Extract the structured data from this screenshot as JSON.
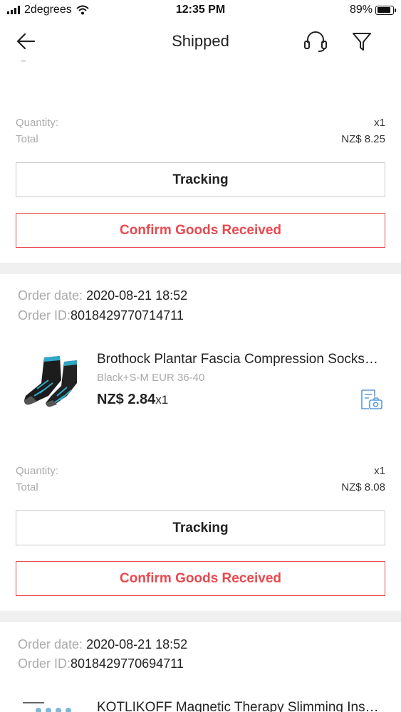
{
  "status_bar": {
    "carrier": "2degrees",
    "time": "12:35 PM",
    "battery_percent": "89%",
    "battery_level": 0.89
  },
  "nav": {
    "title": "Shipped",
    "icons": [
      "back-arrow-icon",
      "headset-icon",
      "filter-icon"
    ]
  },
  "orders": [
    {
      "quantity_label": "Quantity:",
      "quantity": "x1",
      "total_label": "Total",
      "total": "NZ$ 8.25",
      "tracking_label": "Tracking",
      "confirm_label": "Confirm Goods Received"
    },
    {
      "order_date_label": "Order date:",
      "order_date": "2020-08-21 18:52",
      "order_id_label": "Order ID:",
      "order_id": "8018429770714711",
      "product": {
        "title": "Brothock Plantar Fascia Compression Socks…",
        "variant": "Black+S-M EUR 36-40",
        "price": "NZ$ 2.84",
        "qty": "x1"
      },
      "quantity_label": "Quantity:",
      "quantity": "x1",
      "total_label": "Total",
      "total": "NZ$ 8.08",
      "tracking_label": "Tracking",
      "confirm_label": "Confirm Goods Received"
    },
    {
      "order_date_label": "Order date:",
      "order_date": "2020-08-21 18:52",
      "order_id_label": "Order ID:",
      "order_id": "8018429770694711",
      "product": {
        "title": "KOTLIKOFF Magnetic Therapy Slimming Ins…"
      }
    }
  ],
  "colors": {
    "accent_red": "#e8494f",
    "snapshot_blue": "#5b9bd5",
    "divider": "#f0f0f0"
  }
}
